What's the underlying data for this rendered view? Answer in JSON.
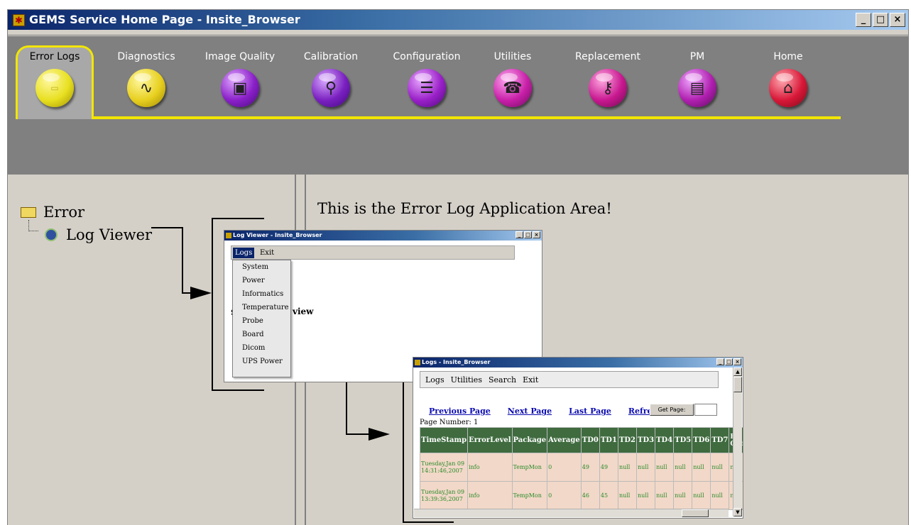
{
  "window": {
    "title": "GEMS Service Home Page - Insite_Browser",
    "icon": "app-icon",
    "buttons": {
      "minimize": "_",
      "maximize": "□",
      "close": "×"
    }
  },
  "nav": {
    "active": "Error Logs",
    "items": [
      {
        "label": "Error Logs",
        "icon": "error-logs-icon",
        "color": "#e8e020"
      },
      {
        "label": "Diagnostics",
        "icon": "stethoscope-icon",
        "color": "#e8d020"
      },
      {
        "label": "Image Quality",
        "icon": "image-quality-icon",
        "color": "#8a20c8"
      },
      {
        "label": "Calibration",
        "icon": "calibration-icon",
        "color": "#7a20c0"
      },
      {
        "label": "Configuration",
        "icon": "configuration-icon",
        "color": "#9a20c8"
      },
      {
        "label": "Utilities",
        "icon": "utilities-icon",
        "color": "#c820a8"
      },
      {
        "label": "Replacement",
        "icon": "replacement-icon",
        "color": "#c81890"
      },
      {
        "label": "PM",
        "icon": "pm-icon",
        "color": "#b020b0"
      },
      {
        "label": "Home",
        "icon": "home-icon",
        "color": "#d81838"
      }
    ],
    "accent_color": "#f2e600"
  },
  "tree": {
    "folder": "Error",
    "child": "Log Viewer"
  },
  "app_area": {
    "message": "This is the Error Log Application Area!"
  },
  "log_viewer_popup": {
    "title": "Log Viewer - Insite_Browser",
    "menus": [
      "Logs",
      "Exit"
    ],
    "dropdown": [
      "System",
      "Power",
      "Informatics",
      "Temperature",
      "Probe",
      "Board",
      "Dicom",
      "UPS Power"
    ],
    "peek_text_left": "S",
    "peek_text_right": "view"
  },
  "logs_popup": {
    "title": "Logs - Insite_Browser",
    "menus": [
      "Logs",
      "Utilities",
      "Search",
      "Exit"
    ],
    "links": [
      "Previous Page",
      "Next Page",
      "Last Page",
      "Refresh"
    ],
    "get_page_label": "Get Page:",
    "page_number": "Page Number: 1",
    "columns": [
      "TimeStamp",
      "ErrorLevel",
      "Package",
      "Average",
      "TD0",
      "TD1",
      "TD2",
      "TD3",
      "TD4",
      "TD5",
      "TD6",
      "TD7",
      "EQ Out"
    ],
    "rows": [
      [
        "Tuesday,Jan 09 14:31:46,2007",
        "info",
        "TempMon",
        "0",
        "49",
        "49",
        "null",
        "null",
        "null",
        "null",
        "null",
        "null",
        "null"
      ],
      [
        "Tuesday,Jan 09 13:39:36,2007",
        "info",
        "TempMon",
        "0",
        "46",
        "45",
        "null",
        "null",
        "null",
        "null",
        "null",
        "null",
        "null"
      ]
    ]
  }
}
